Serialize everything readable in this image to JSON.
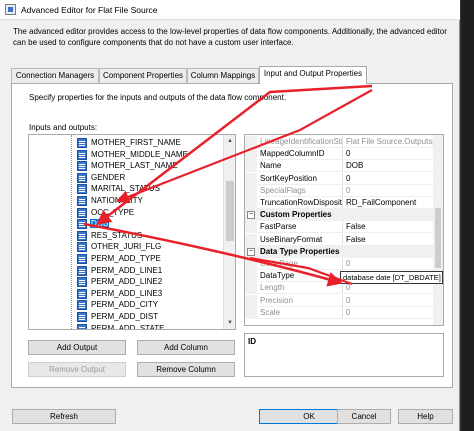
{
  "window": {
    "title": "Advanced Editor for Flat File Source"
  },
  "description": "The advanced editor provides access to the low-level properties of data flow components. Additionally, the advanced editor can be used to configure components that do not have a custom user interface.",
  "tabs": [
    {
      "label": "Connection Managers"
    },
    {
      "label": "Component Properties"
    },
    {
      "label": "Column Mappings"
    },
    {
      "label": "Input and Output Properties"
    }
  ],
  "panel": {
    "description": "Specify properties for the inputs and outputs of the data flow component.",
    "io_label": "Inputs and outputs:"
  },
  "tree": {
    "items": [
      {
        "label": "MOTHER_FIRST_NAME"
      },
      {
        "label": "MOTHER_MIDDLE_NAME"
      },
      {
        "label": "MOTHER_LAST_NAME"
      },
      {
        "label": "GENDER"
      },
      {
        "label": "MARITAL_STATUS"
      },
      {
        "label": "NATIONALITY"
      },
      {
        "label": "OCC_TYPE"
      },
      {
        "label": "DOB",
        "selected": true
      },
      {
        "label": "RES_STATUS"
      },
      {
        "label": "OTHER_JURI_FLG"
      },
      {
        "label": "PERM_ADD_TYPE"
      },
      {
        "label": "PERM_ADD_LINE1"
      },
      {
        "label": "PERM_ADD_LINE2"
      },
      {
        "label": "PERM_ADD_LINE3"
      },
      {
        "label": "PERM_ADD_CITY"
      },
      {
        "label": "PERM_ADD_DIST"
      },
      {
        "label": "PERM_ADD_STATE"
      }
    ]
  },
  "buttons": {
    "add_output": "Add Output",
    "add_column": "Add Column",
    "remove_output": "Remove Output",
    "remove_column": "Remove Column",
    "refresh": "Refresh",
    "ok": "OK",
    "cancel": "Cancel",
    "help": "Help"
  },
  "properties": {
    "rows": [
      {
        "name": "LineageIdentificationString",
        "value": "Flat File Source.Outputs[Fla",
        "readonly": true
      },
      {
        "name": "MappedColumnID",
        "value": "0"
      },
      {
        "name": "Name",
        "value": "DOB"
      },
      {
        "name": "SortKeyPosition",
        "value": "0"
      },
      {
        "name": "SpecialFlags",
        "value": "0",
        "readonly": true
      },
      {
        "name": "TruncationRowDisposition",
        "value": "RD_FailComponent"
      },
      {
        "category": "Custom Properties"
      },
      {
        "name": "FastParse",
        "value": "False"
      },
      {
        "name": "UseBinaryFormat",
        "value": "False"
      },
      {
        "category": "Data Type Properties"
      },
      {
        "name": "CodePage",
        "value": "0",
        "readonly": true
      },
      {
        "name": "DataType",
        "value": ""
      },
      {
        "name": "Length",
        "value": "0",
        "readonly": true
      },
      {
        "name": "Precision",
        "value": "0",
        "readonly": true
      },
      {
        "name": "Scale",
        "value": "0",
        "readonly": true
      }
    ],
    "datatype_value": "database date [DT_DBDATE]",
    "description_title": "ID"
  },
  "colors": {
    "arrow": "#e8202a",
    "selection": "#0078d7",
    "ok_border": "#0078d7"
  }
}
